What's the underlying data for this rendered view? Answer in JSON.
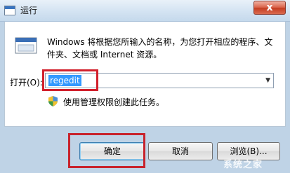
{
  "window": {
    "title": "运行",
    "close_glyph": "x"
  },
  "content": {
    "description": "Windows 将根据您所输入的名称，为您打开相应的程序、文件夹、文档或 Internet 资源。",
    "open_label": "打开(O):",
    "input_value": "regedit",
    "admin_note": "使用管理权限创建此任务。"
  },
  "buttons": {
    "ok": "确定",
    "cancel": "取消",
    "browse": "浏览(B)..."
  },
  "watermark": {
    "text": "系统之家"
  },
  "colors": {
    "highlight": "#d2202c",
    "selection": "#3399ff",
    "close": "#c43d22"
  },
  "icons": [
    "run-program-icon",
    "dropdown-arrow-icon",
    "uac-shield-icon"
  ]
}
